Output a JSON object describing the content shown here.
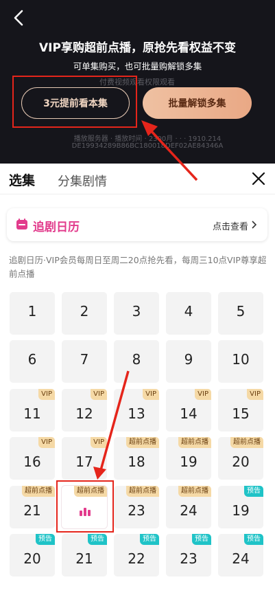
{
  "header": {
    "title": "VIP享购超前点播，原抢先看权益不变",
    "subtitle": "可单集购买，也可批量购解锁多集",
    "watermark_lines": [
      "付费视频观看权限观看",
      "播放服务器 · 播放时间 · 2300月 · · · 1910.214",
      "DE19934289B86BC180018DEF02AE84346A"
    ]
  },
  "buttons": {
    "single_label": "3元提前看本集",
    "batch_label": "批量解锁多集"
  },
  "tabs": [
    {
      "label": "选集"
    },
    {
      "label": "分集剧情"
    }
  ],
  "calendar": {
    "title": "追剧日历",
    "link": "点击查看"
  },
  "description": "追剧日历·VIP会员每周日至周二20点抢先看，每周三10点VIP尊享超前点播",
  "episodes": [
    {
      "num": "1",
      "badge": ""
    },
    {
      "num": "2",
      "badge": ""
    },
    {
      "num": "3",
      "badge": ""
    },
    {
      "num": "4",
      "badge": ""
    },
    {
      "num": "5",
      "badge": ""
    },
    {
      "num": "6",
      "badge": ""
    },
    {
      "num": "7",
      "badge": ""
    },
    {
      "num": "8",
      "badge": ""
    },
    {
      "num": "9",
      "badge": ""
    },
    {
      "num": "10",
      "badge": ""
    },
    {
      "num": "11",
      "badge": "VIP"
    },
    {
      "num": "12",
      "badge": "VIP"
    },
    {
      "num": "13",
      "badge": "VIP"
    },
    {
      "num": "14",
      "badge": "VIP"
    },
    {
      "num": "15",
      "badge": "VIP"
    },
    {
      "num": "16",
      "badge": "VIP"
    },
    {
      "num": "17",
      "badge": "VIP"
    },
    {
      "num": "18",
      "badge": "超前点播"
    },
    {
      "num": "19",
      "badge": "超前点播"
    },
    {
      "num": "20",
      "badge": "超前点播"
    },
    {
      "num": "21",
      "badge": "超前点播"
    },
    {
      "num": "",
      "badge": "超前点播",
      "current": true
    },
    {
      "num": "23",
      "badge": "超前点播"
    },
    {
      "num": "24",
      "badge": "超前点播"
    },
    {
      "num": "19",
      "badge": "预告"
    },
    {
      "num": "20",
      "badge": "预告"
    },
    {
      "num": "21",
      "badge": "预告"
    },
    {
      "num": "22",
      "badge": "预告"
    },
    {
      "num": "23",
      "badge": "预告"
    },
    {
      "num": "24",
      "badge": "预告"
    }
  ],
  "colors": {
    "accent_pink": "#e23b8c",
    "vip_gold": "#f5d9a6",
    "preview_teal": "#1fc3c7",
    "annotation_red": "#e5251b"
  }
}
